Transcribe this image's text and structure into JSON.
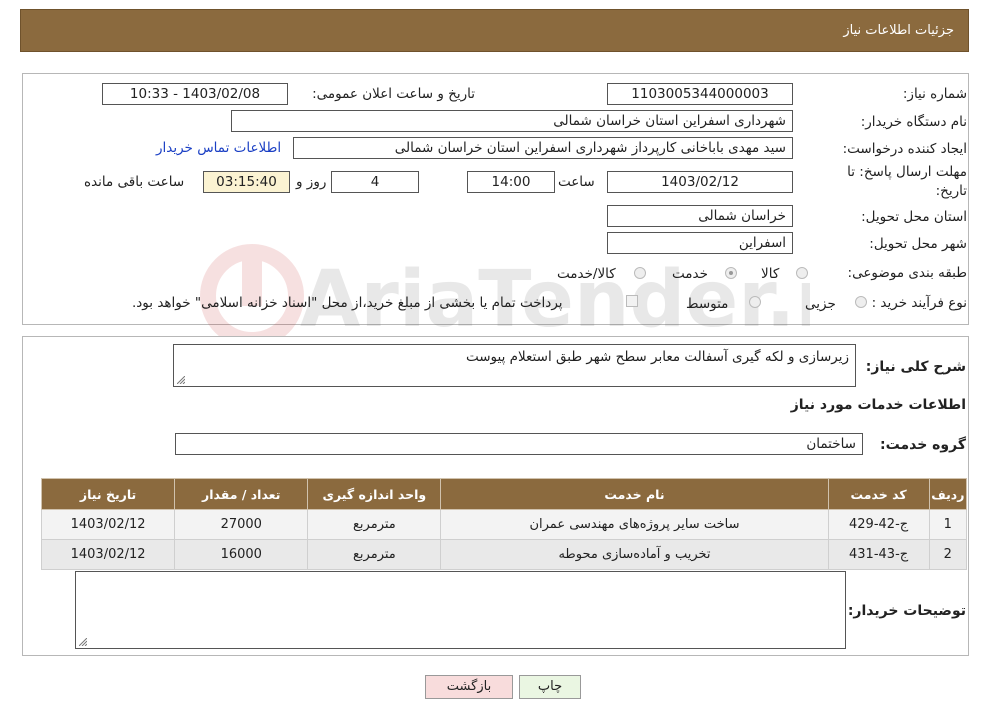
{
  "header": {
    "title": "جزئیات اطلاعات نیاز"
  },
  "form": {
    "need_number_label": "شماره نیاز:",
    "need_number": "1103005344000003",
    "announce_label": "تاریخ و ساعت اعلان عمومی:",
    "announce_value": "1403/02/08 - 10:33",
    "buyer_org_label": "نام دستگاه خریدار:",
    "buyer_org": "شهرداری اسفراین استان خراسان شمالی",
    "creator_label": "ایجاد کننده درخواست:",
    "creator": "سید مهدی  باباخانی کارپرداز   شهرداری اسفراین استان خراسان شمالی",
    "contact_link": "اطلاعات تماس خریدار",
    "deadline_label_1": "مهلت ارسال پاسخ: تا",
    "deadline_label_2": "تاریخ:",
    "deadline_date": "1403/02/12",
    "time_label": "ساعت",
    "deadline_time": "14:00",
    "days_value": "4",
    "days_label": "روز و",
    "remaining_value": "03:15:40",
    "remaining_label": "ساعت باقی مانده",
    "province_label": "استان محل تحویل:",
    "province": "خراسان شمالی",
    "city_label": "شهر محل تحویل:",
    "city": "اسفراین",
    "category_label": "طبقه بندی موضوعی:",
    "category_options": [
      "کالا",
      "خدمت",
      "کالا/خدمت"
    ],
    "category_selected": "خدمت",
    "process_label": "نوع فرآیند خرید :",
    "process_options": [
      "جزیی",
      "متوسط"
    ],
    "payment_note": "پرداخت تمام یا بخشی از مبلغ خرید،از محل \"اسناد خزانه اسلامی\" خواهد بود."
  },
  "details": {
    "summary_label": "شرح کلی نیاز:",
    "summary": "زیرسازی و لکه گیری آسفالت معابر سطح شهر طبق استعلام پیوست",
    "services_title": "اطلاعات خدمات مورد نیاز",
    "group_label": "گروه خدمت:",
    "group": "ساختمان",
    "table_headers": [
      "ردیف",
      "کد خدمت",
      "نام خدمت",
      "واحد اندازه گیری",
      "تعداد / مقدار",
      "تاریخ نیاز"
    ],
    "rows": [
      [
        "1",
        "ج-42-429",
        "ساخت سایر پروژه‌های مهندسی عمران",
        "مترمربع",
        "27000",
        "1403/02/12"
      ],
      [
        "2",
        "ج-43-431",
        "تخریب و آماده‌سازی محوطه",
        "مترمربع",
        "16000",
        "1403/02/12"
      ]
    ],
    "buyer_notes_label": "توضیحات خریدار:",
    "buyer_notes": ""
  },
  "buttons": {
    "print": "چاپ",
    "back": "بازگشت"
  },
  "watermark": "AriaTender.net",
  "colors": {
    "header_bg": "#8b6a3e",
    "link": "#1a3fc4"
  }
}
